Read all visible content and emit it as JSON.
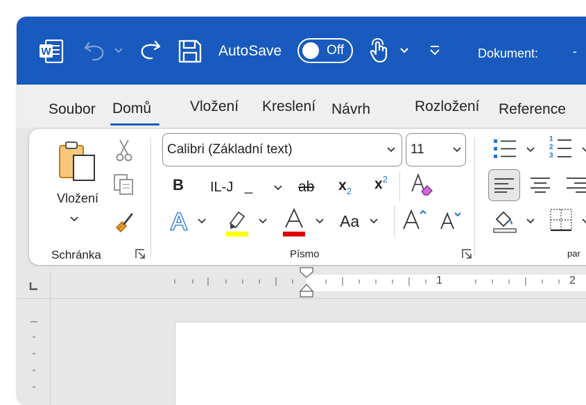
{
  "titlebar": {
    "autosave_label": "AutoSave",
    "autosave_state": "Off",
    "document_label": "Dokument:",
    "title_dash": "-"
  },
  "tabs": [
    {
      "label": "Soubor"
    },
    {
      "label": "Domů",
      "active": true
    },
    {
      "label": "Vložení"
    },
    {
      "label": "Kreslení"
    },
    {
      "label": "Návrh"
    },
    {
      "label": "Rozložení"
    },
    {
      "label": "Reference"
    }
  ],
  "clipboard": {
    "paste_label": "Vložení",
    "group_label": "Schránka"
  },
  "font": {
    "font_name": "Calibri (Základní text)",
    "font_size": "11",
    "bold": "B",
    "underline": "IL-J",
    "underline_tail": "_",
    "strike": "ab",
    "sub_base": "x",
    "sub_mark": "2",
    "sup_base": "x",
    "sup_mark": "2",
    "change_case": "Aa",
    "group_label": "Písmo"
  },
  "paragraph": {
    "group_label": "par",
    "numbering_digits": [
      "1",
      "2",
      "3"
    ]
  },
  "ruler": {
    "marks": [
      "1",
      "2"
    ]
  },
  "colors": {
    "title_blue": "#185abd",
    "highlight_yellow": "#ffff00",
    "font_red": "#e00000",
    "accent_blue": "#1e73d4"
  }
}
